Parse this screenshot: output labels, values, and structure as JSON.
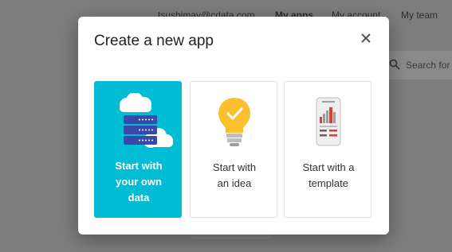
{
  "header": {
    "email": "tsushimay@cdata.com",
    "nav": [
      {
        "label": "My apps",
        "active": true
      },
      {
        "label": "My account",
        "active": false
      },
      {
        "label": "My team",
        "active": false
      }
    ]
  },
  "search": {
    "placeholder": "Search for"
  },
  "dialog": {
    "title": "Create a new app",
    "close_icon": "close-icon",
    "options": [
      {
        "line1": "Start with",
        "line2": "your own",
        "line3": "data",
        "icon": "server-cloud-icon",
        "selected": true
      },
      {
        "line1": "Start with",
        "line2": "an idea",
        "icon": "lightbulb-icon",
        "selected": false
      },
      {
        "line1": "Start with a",
        "line2": "template",
        "icon": "phone-template-icon",
        "selected": false
      }
    ]
  },
  "colors": {
    "accent": "#00bcd4",
    "bulb": "#fbc02d",
    "overlay": "#7d7d7d"
  }
}
